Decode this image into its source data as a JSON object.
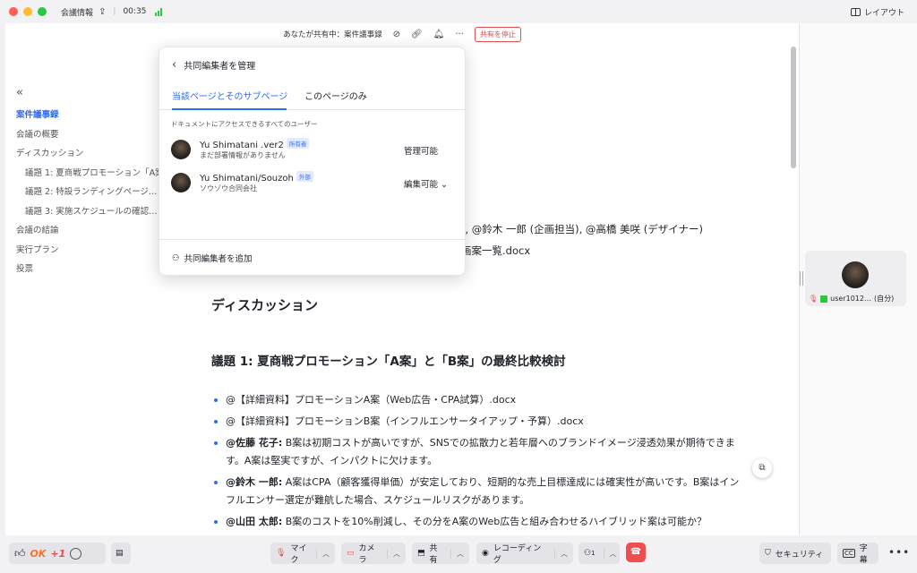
{
  "titlebar": {
    "title": "会議情報",
    "time": "00:35",
    "layout": "レイアウト"
  },
  "sharebar": {
    "status": "あなたが共有中：案件議事録",
    "stop": "共有を停止"
  },
  "toc": {
    "items": [
      {
        "label": "案件議事録",
        "active": true
      },
      {
        "label": "会議の概要"
      },
      {
        "label": "ディスカッション"
      },
      {
        "label": "議題 1: 夏商戦プロモーション「A案」と「B案」の最終比較検討",
        "sub": true
      },
      {
        "label": "議題 2: 特設ランディングページ…",
        "sub": true
      },
      {
        "label": "議題 3: 実施スケジュールの確認…",
        "sub": true
      },
      {
        "label": "会議の結論"
      },
      {
        "label": "実行プラン"
      },
      {
        "label": "投票"
      }
    ]
  },
  "doc": {
    "attendees_tail": "), @鈴木 一郎 (企画担当), @高橋 美咲 (デザイナー)",
    "attachment_tail": "画案一覧.docx",
    "section_title": "ディスカッション",
    "agenda1_title": "議題 1: 夏商戦プロモーション「A案」と「B案」の最終比較検討",
    "bullets": [
      {
        "text": "@【詳細資料】プロモーションA案（Web広告・CPA試算）.docx"
      },
      {
        "text": "@【詳細資料】プロモーションB案（インフルエンサータイアップ・予算）.docx"
      },
      {
        "name": "@佐藤 花子:",
        "text": " B案は初期コストが高いですが、SNSでの拡散力と若年層へのブランドイメージ浸透効果が期待できます。A案は堅実ですが、インパクトに欠けます。"
      },
      {
        "name": "@鈴木 一郎:",
        "text": " A案はCPA（顧客獲得単価）が安定しており、短期的な売上目標達成には確実性が高いです。B案はインフルエンサー選定が難航した場合、スケジュールリスクがあります。"
      },
      {
        "name": "@山田 太郎:",
        "text": " B案のコストを10%削減し、その分をA案のWeb広告と組み合わせるハイブリッド案は可能か？"
      }
    ]
  },
  "popup": {
    "title": "共同編集者を管理",
    "tabs": [
      "当該ページとそのサブページ",
      "このページのみ"
    ],
    "access_label": "ドキュメントにアクセスできるすべてのユーザー",
    "users": [
      {
        "name": "Yu Shimatani .ver2",
        "badge": "所有者",
        "sub": "まだ部署情報がありません",
        "permission": "管理可能"
      },
      {
        "name": "Yu Shimatani/Souzoh",
        "badge": "外部",
        "sub": "ソウゾウ合同会社",
        "permission": "編集可能"
      }
    ],
    "add": "共同編集者を追加"
  },
  "participant": {
    "name": "user1012…",
    "self": "(自分)"
  },
  "toolbar": {
    "reactions": {
      "ok": "OK",
      "plus_one": "+1"
    },
    "mic": "マイク",
    "camera": "カメラ",
    "share": "共有",
    "recording": "レコーディング",
    "participants_count": "1",
    "security": "セキュリティ",
    "captions": "字幕",
    "cc": "CC"
  },
  "colors": {
    "accent": "#2f6bf5",
    "danger": "#e34d4d"
  }
}
